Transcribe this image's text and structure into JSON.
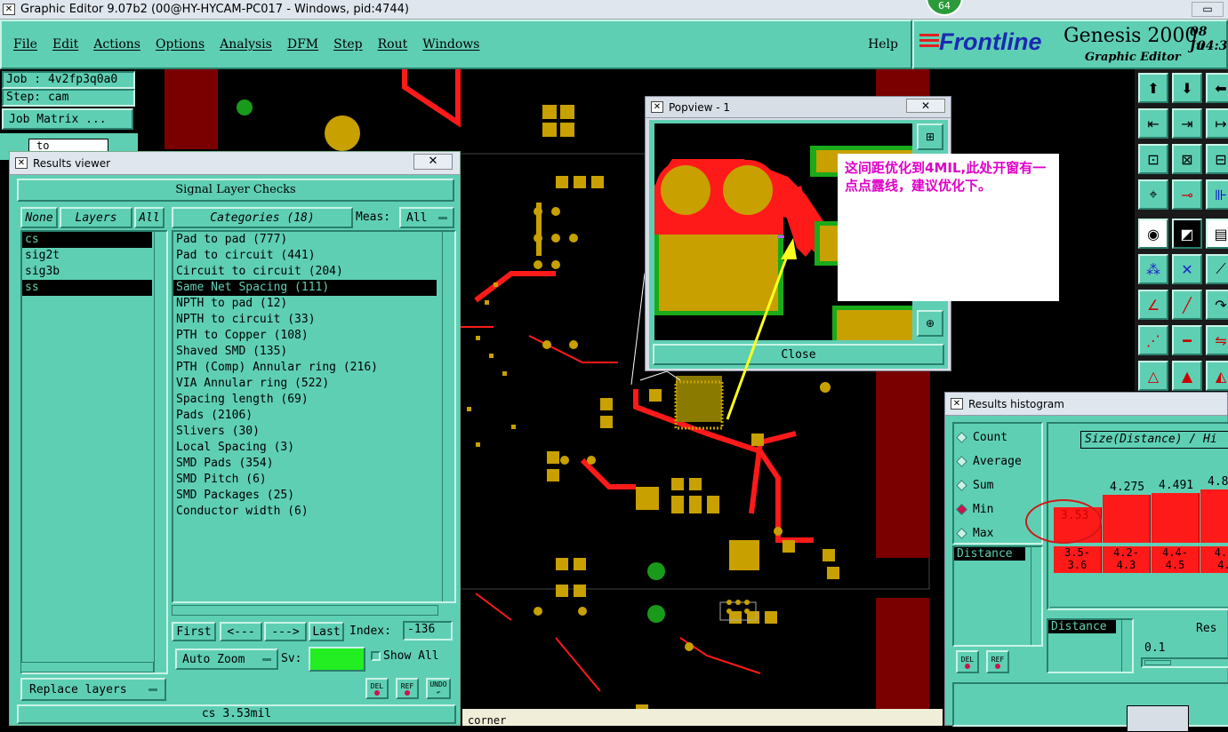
{
  "app": {
    "window_title": "Graphic Editor 9.07b2 (00@HY-HYCAM-PC017 - Windows, pid:4744)",
    "badge": "64"
  },
  "menu": {
    "items": [
      "File",
      "Edit",
      "Actions",
      "Options",
      "Analysis",
      "DFM",
      "Step",
      "Rout",
      "Windows"
    ],
    "help": "Help"
  },
  "brand": {
    "logo": "Frontline",
    "product": "Genesis 2000",
    "subtitle": "Graphic Editor",
    "date": "08 Ju",
    "time": "04:3"
  },
  "job": {
    "job_label": "Job : 4v2fp3q0a0",
    "step_label": "Step: cam",
    "matrix_button": "Job Matrix ...",
    "to_field": "to"
  },
  "results_viewer": {
    "title": "Results viewer",
    "header": "Signal Layer Checks",
    "none_btn": "None",
    "layers_label": "Layers",
    "all_btn": "All",
    "categories_label": "Categories (18)",
    "meas_label": "Meas:",
    "meas_value": "All",
    "layers": [
      "cs",
      "sig2t",
      "sig3b",
      "ss"
    ],
    "categories": [
      "Pad to pad (777)",
      "Pad to circuit (441)",
      "Circuit to circuit (204)",
      "Same Net Spacing (111)",
      "NPTH to pad (12)",
      "NPTH to circuit (33)",
      "PTH to Copper (108)",
      "Shaved SMD (135)",
      "PTH (Comp) Annular ring (216)",
      "VIA Annular ring (522)",
      "Spacing length (69)",
      "Pads (2106)",
      "Slivers (30)",
      "Local Spacing (3)",
      "SMD Pads (354)",
      "SMD Pitch (6)",
      "SMD Packages (25)",
      "Conductor width (6)"
    ],
    "first_btn": "First",
    "prev_btn": "<---",
    "next_btn": "--->",
    "last_btn": "Last",
    "index_label": "Index:",
    "index_value": "-136",
    "auto_zoom": "Auto Zoom",
    "sv_label": "Sv:",
    "show_all": "Show All",
    "replace_layers": "Replace layers",
    "del": "DEL",
    "ref": "REF",
    "undo": "UNDO",
    "status": "cs 3.53mil"
  },
  "popview": {
    "title": "Popview - 1",
    "annotation": "这间距优化到4MIL,此处开窗有一点点露线，建议优化下。",
    "close_btn": "Close"
  },
  "histogram": {
    "title": "Results histogram",
    "modes": [
      "Count",
      "Average",
      "Sum",
      "Min",
      "Max"
    ],
    "selected_mode": "Min",
    "axis_title": "Size(Distance) / Hi",
    "bar_values": [
      "3.53",
      "4.275",
      "4.491",
      "4.8"
    ],
    "bin_labels": [
      "3.5-\n3.6",
      "4.2-\n4.3",
      "4.4-\n4.5",
      "4.8\n4."
    ],
    "distance_label": "Distance",
    "distance_label2": "Distance",
    "res_label": "Res",
    "res_value": "0.1",
    "del": "DEL",
    "ref": "REF"
  },
  "canvas": {
    "status_text": "corner"
  },
  "colors": {
    "ui_teal": "#5fcfb4",
    "pad_gold": "#c8a000",
    "trace_red": "#ff1a1a",
    "annotation_magenta": "#e000c8"
  }
}
